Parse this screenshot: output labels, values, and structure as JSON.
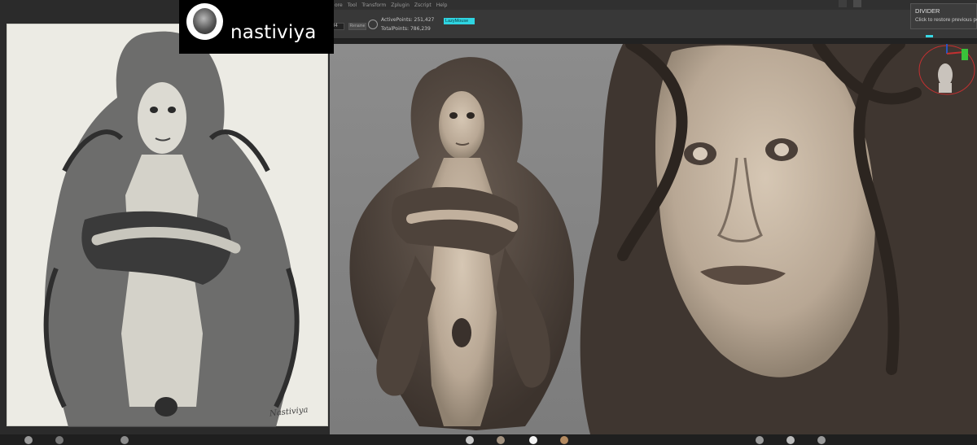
{
  "profile": {
    "username": "nastiviya"
  },
  "menubar": {
    "items": [
      "ore",
      "Tool",
      "Transform",
      "Zplugin",
      "Zscript",
      "Help"
    ]
  },
  "toolbar": {
    "field_value": "94",
    "button_label": "Rename",
    "active_points": "ActivePoints: 251,427",
    "total_points": "TotalPoints: 786,239",
    "lazymouse_label": "LazyMouse"
  },
  "tooltip": {
    "title": "DIVIDER",
    "text": "Click to restore previous po"
  },
  "reference": {
    "signature": "Nastiviya"
  },
  "colors": {
    "accent": "#2fd5e2",
    "clay": "#cbbba8",
    "hair_clay": "#54483f",
    "viewport_bg": "#858585",
    "paper": "#ecebe4"
  }
}
